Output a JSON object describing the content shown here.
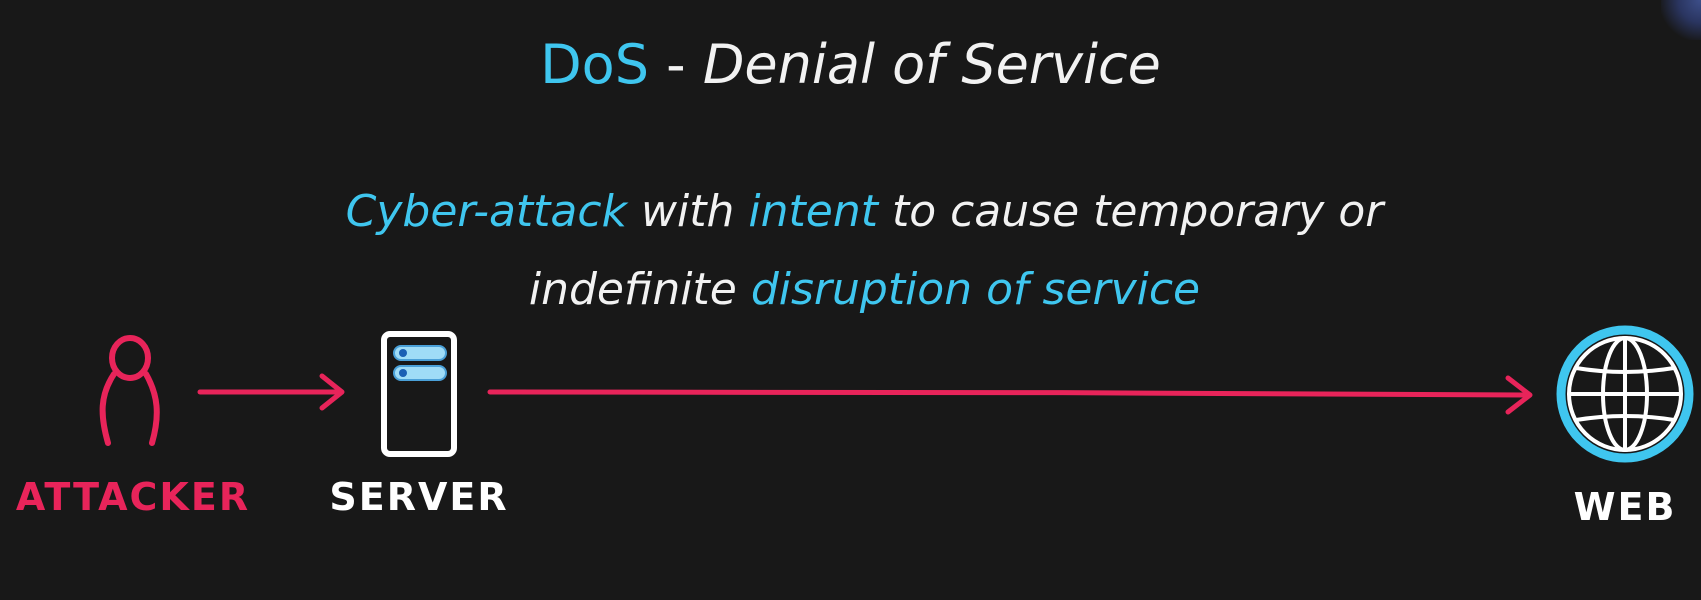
{
  "title": {
    "acronym": "DoS",
    "separator": " - ",
    "full": "Denial of Service"
  },
  "definition": {
    "line1": [
      {
        "text": "Cyber-attack",
        "highlight": true
      },
      {
        "text": " with ",
        "highlight": false
      },
      {
        "text": "intent",
        "highlight": true
      },
      {
        "text": " to cause temporary or",
        "highlight": false
      }
    ],
    "line2": [
      {
        "text": "indefinite ",
        "highlight": false
      },
      {
        "text": "disruption of service",
        "highlight": true
      }
    ]
  },
  "nodes": {
    "attacker": {
      "label": "ATTACKER",
      "icon": "person-icon",
      "color": "#e8245a"
    },
    "server": {
      "label": "SERVER",
      "icon": "server-icon",
      "color": "#ffffff"
    },
    "web": {
      "label": "WEB",
      "icon": "globe-icon",
      "color": "#ffffff"
    }
  },
  "colors": {
    "accent": "#3fc6ef",
    "arrow": "#e8245a",
    "background": "#181818",
    "text": "#f2f2f2"
  }
}
